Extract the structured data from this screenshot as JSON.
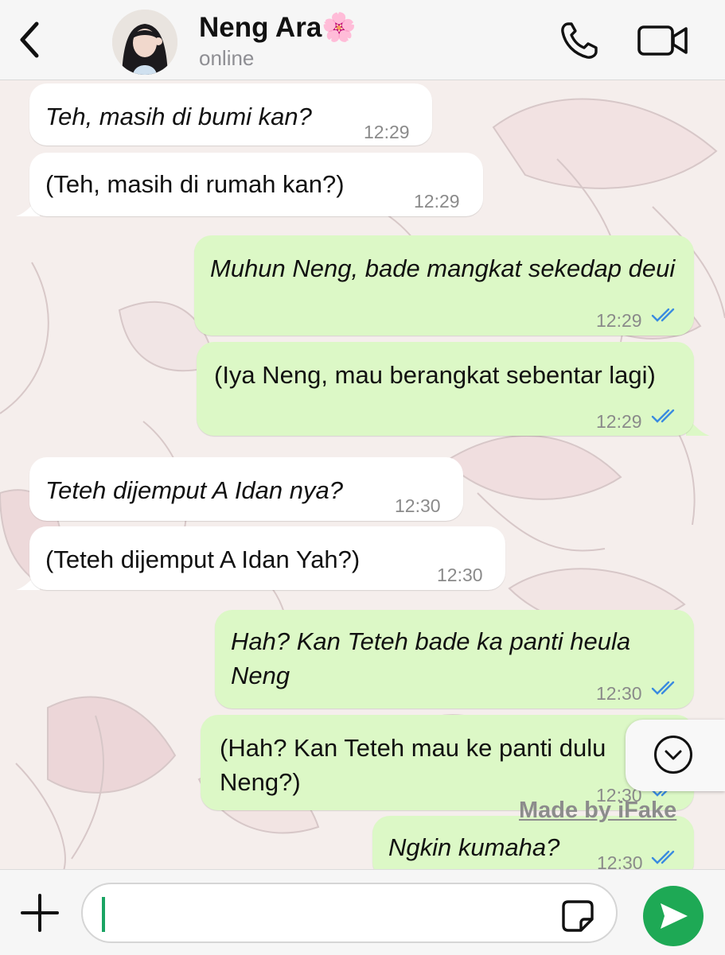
{
  "header": {
    "contact_name": "Neng Ara",
    "contact_emoji": "🌸",
    "status": "online"
  },
  "messages": [
    {
      "dir": "in",
      "text": "Teh, masih di bumi kan?",
      "italic_part": "Teh, masih di bumi kan",
      "time": "12:29"
    },
    {
      "dir": "in",
      "text": "(Teh, masih di rumah kan?)",
      "time": "12:29"
    },
    {
      "dir": "out",
      "text": "Muhun Neng, bade mangkat sekedap deui",
      "time": "12:29",
      "read": true
    },
    {
      "dir": "out",
      "text": "(Iya Neng, mau berangkat sebentar lagi)",
      "time": "12:29",
      "read": true
    },
    {
      "dir": "in",
      "text": "Teteh dijemput A Idan nya?",
      "time": "12:30"
    },
    {
      "dir": "in",
      "text": "(Teteh dijemput A Idan Yah?)",
      "time": "12:30"
    },
    {
      "dir": "out",
      "text": "Hah? Kan Teteh bade ka panti heula Neng",
      "time": "12:30",
      "read": true
    },
    {
      "dir": "out",
      "text": "(Hah? Kan Teteh mau ke panti dulu Neng?)",
      "time": "12:30",
      "read": true
    },
    {
      "dir": "out",
      "text": "Ngkin kumaha?",
      "time": "12:30",
      "read": true
    }
  ],
  "watermark": "Made by iFake",
  "composer": {
    "value": ""
  },
  "colors": {
    "outgoing_bubble": "#dcf8c6",
    "incoming_bubble": "#ffffff",
    "send_button": "#1ea955",
    "read_ticks": "#3a8be0"
  }
}
